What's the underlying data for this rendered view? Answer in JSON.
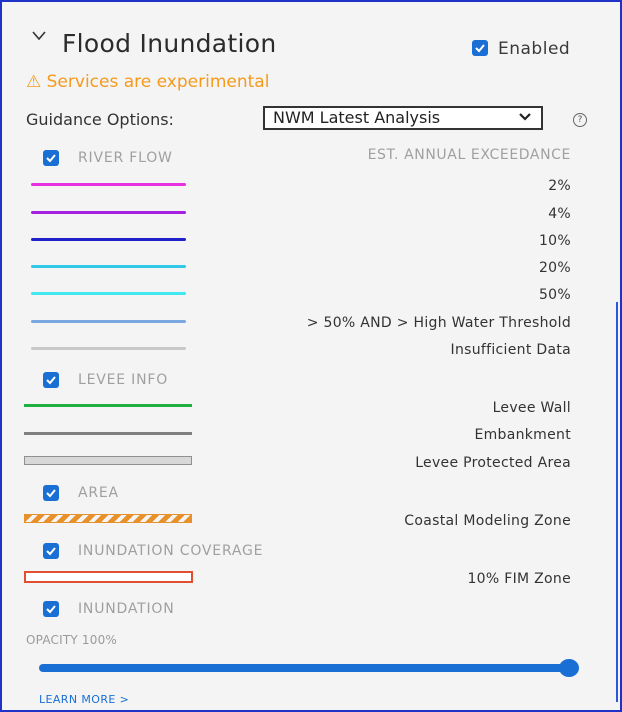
{
  "header": {
    "title": "Flood Inundation",
    "enabled_label": "Enabled",
    "enabled_checked": true,
    "warning": "⚠ Services are experimental"
  },
  "guidance": {
    "label": "Guidance Options:",
    "selected": "NWM Latest Analysis",
    "help": "?"
  },
  "river_flow": {
    "label": "RIVER FLOW",
    "checked": true,
    "column_header": "EST. ANNUAL EXCEEDANCE",
    "items": [
      {
        "label": "2%",
        "color": "#e830e0"
      },
      {
        "label": "4%",
        "color": "#a520e0"
      },
      {
        "label": "10%",
        "color": "#2020c8"
      },
      {
        "label": "20%",
        "color": "#30c8e8"
      },
      {
        "label": "50%",
        "color": "#40e8f0"
      },
      {
        "label": "> 50% AND > High Water Threshold",
        "color": "#7aa8e0"
      },
      {
        "label": "Insufficient Data",
        "color": "#c8c8c8"
      }
    ]
  },
  "levee_info": {
    "label": "LEVEE INFO",
    "checked": true,
    "items": [
      {
        "label": "Levee Wall",
        "color": "#20b040"
      },
      {
        "label": "Embankment",
        "color": "#808080"
      },
      {
        "label": "Levee Protected Area",
        "color": "#d0d0d0"
      }
    ]
  },
  "area": {
    "label": "AREA",
    "checked": true,
    "items": [
      {
        "label": "Coastal Modeling Zone",
        "color": "#e8902a"
      }
    ]
  },
  "inundation_coverage": {
    "label": "INUNDATION COVERAGE",
    "checked": true,
    "items": [
      {
        "label": "10% FIM Zone",
        "color": "#e05030"
      }
    ]
  },
  "inundation": {
    "label": "INUNDATION",
    "checked": true,
    "opacity_label": "OPACITY 100%",
    "opacity_value": 100
  },
  "footer": {
    "learn_more": "LEARN MORE >"
  },
  "colors": {
    "accent": "#1a6fd4",
    "warning": "#f59a1b"
  }
}
